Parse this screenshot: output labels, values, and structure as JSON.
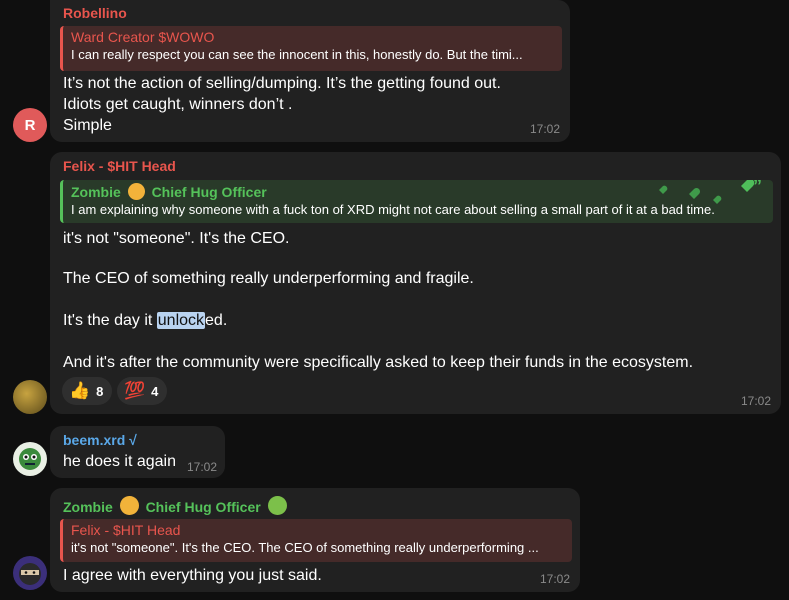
{
  "messages": [
    {
      "sender": "Robellino",
      "sender_color": "#e8554d",
      "reply": {
        "title": "Ward Creator $WOWO",
        "text": "I can really respect you can see the innocent in this, honestly do. But the timi..."
      },
      "lines": [
        "It’s not the action of selling/dumping. It’s the getting found out.",
        "Idiots get caught, winners don’t .",
        "Simple"
      ],
      "time": "17:02",
      "avatar_letter": "R"
    },
    {
      "sender": "Felix - $HIT Head",
      "sender_color": "#e8554d",
      "reply": {
        "title_name": "Zombie",
        "title_suffix": "Chief Hug Officer",
        "text": "I am explaining why someone with a fuck ton of XRD might not care about selling a small part of it at a bad time."
      },
      "line1": "it's not \"someone\". It's the CEO.",
      "line2": "The CEO of something really underperforming and fragile.",
      "line3_pre": "It's the day it ",
      "line3_hl": "unlock",
      "line3_post": "ed.",
      "line4": "And it's after the community were specifically asked to keep their funds in the ecosystem.",
      "reactions": [
        {
          "emoji": "👍",
          "count": "8"
        },
        {
          "emoji": "💯",
          "count": "4"
        }
      ],
      "time": "17:02"
    },
    {
      "sender": "beem.xrd √",
      "sender_color": "#5aa8e8",
      "text": "he does it again",
      "time": "17:02"
    },
    {
      "sender_name": "Zombie",
      "sender_suffix": "Chief Hug Officer",
      "sender_color": "#55c25a",
      "reply": {
        "title": "Felix - $HIT Head",
        "text": "it's not \"someone\". It's the CEO. The CEO of something really underperforming ..."
      },
      "text": "I agree with everything you just said.",
      "time": "17:02"
    }
  ],
  "colors": {
    "red_name": "#e8554d",
    "green_name": "#55c25a",
    "blue_name": "#5aa8e8",
    "bubble": "#212121",
    "background": "#0f0f0f"
  }
}
